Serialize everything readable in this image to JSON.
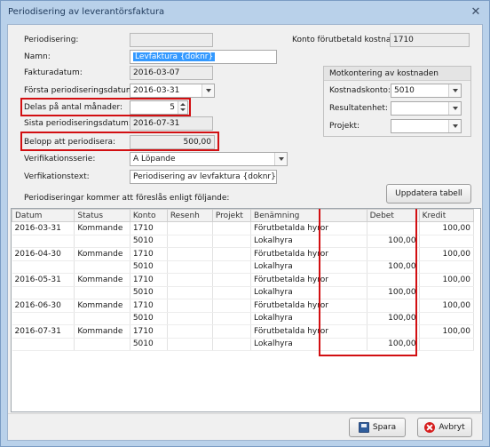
{
  "window": {
    "title": "Periodisering av leverantörsfaktura",
    "close": "✕"
  },
  "form": {
    "periodisering_label": "Periodisering:",
    "periodisering_value": "",
    "namn_label": "Namn:",
    "namn_value": "Levfaktura {doknr}",
    "fakturadatum_label": "Fakturadatum:",
    "fakturadatum_value": "2016-03-07",
    "forsta_label": "Första periodiseringsdatum:",
    "forsta_value": "2016-03-31",
    "delas_label": "Delas på antal månader:",
    "delas_value": "5",
    "sista_label": "Sista periodiseringsdatum:",
    "sista_value": "2016-07-31",
    "belopp_label": "Belopp att periodisera:",
    "belopp_value": "500,00",
    "verserie_label": "Verifikationsserie:",
    "verserie_value": "A Löpande",
    "vertext_label": "Verfikationstext:",
    "vertext_value": "Periodisering av levfaktura {doknr}",
    "konto_label": "Konto förutbetald kostnad:",
    "konto_value": "1710"
  },
  "motkontering": {
    "title": "Motkontering av kostnaden",
    "kostnadskonto_label": "Kostnadskonto:",
    "kostnadskonto_value": "5010",
    "resultatenhet_label": "Resultatenhet:",
    "resultatenhet_value": "",
    "projekt_label": "Projekt:",
    "projekt_value": ""
  },
  "list_caption": "Periodiseringar kommer att föreslås enligt följande:",
  "update_button": "Uppdatera tabell",
  "table": {
    "columns": [
      "Datum",
      "Status",
      "Konto",
      "Resenh",
      "Projekt",
      "Benämning",
      "Debet",
      "Kredit"
    ],
    "rows": [
      [
        "2016-03-31",
        "Kommande",
        "1710",
        "",
        "",
        "Förutbetalda hyror",
        "",
        "100,00"
      ],
      [
        "",
        "",
        "5010",
        "",
        "",
        "Lokalhyra",
        "100,00",
        ""
      ],
      [
        "2016-04-30",
        "Kommande",
        "1710",
        "",
        "",
        "Förutbetalda hyror",
        "",
        "100,00"
      ],
      [
        "",
        "",
        "5010",
        "",
        "",
        "Lokalhyra",
        "100,00",
        ""
      ],
      [
        "2016-05-31",
        "Kommande",
        "1710",
        "",
        "",
        "Förutbetalda hyror",
        "",
        "100,00"
      ],
      [
        "",
        "",
        "5010",
        "",
        "",
        "Lokalhyra",
        "100,00",
        ""
      ],
      [
        "2016-06-30",
        "Kommande",
        "1710",
        "",
        "",
        "Förutbetalda hyror",
        "",
        "100,00"
      ],
      [
        "",
        "",
        "5010",
        "",
        "",
        "Lokalhyra",
        "100,00",
        ""
      ],
      [
        "2016-07-31",
        "Kommande",
        "1710",
        "",
        "",
        "Förutbetalda hyror",
        "",
        "100,00"
      ],
      [
        "",
        "",
        "5010",
        "",
        "",
        "Lokalhyra",
        "100,00",
        ""
      ]
    ]
  },
  "buttons": {
    "save": "Spara",
    "cancel": "Avbryt"
  },
  "colors": {
    "highlight": "#d20f12",
    "selection": "#3399ff",
    "window": "#b9d1ea"
  },
  "icons": {
    "save": "save-icon",
    "cancel": "cancel-icon",
    "close": "close-icon"
  }
}
